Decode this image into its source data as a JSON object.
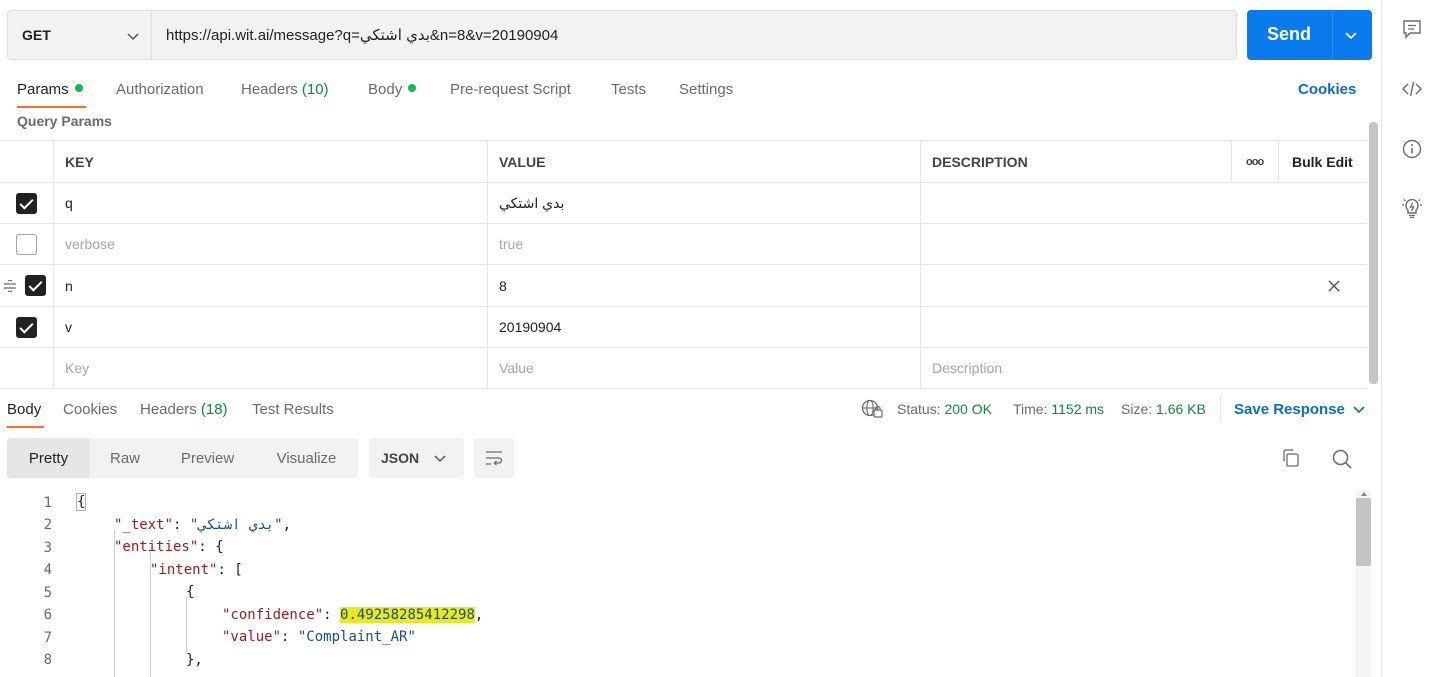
{
  "request": {
    "method": "GET",
    "url": "https://api.wit.ai/message?q=بدي اشتكي&n=8&v=20190904",
    "send_label": "Send"
  },
  "request_tabs": {
    "params": "Params",
    "authorization": "Authorization",
    "headers": "Headers",
    "headers_count": "(10)",
    "body": "Body",
    "pre_request": "Pre-request Script",
    "tests": "Tests",
    "settings": "Settings",
    "cookies": "Cookies"
  },
  "query_params": {
    "title": "Query Params",
    "columns": {
      "key": "KEY",
      "value": "VALUE",
      "description": "DESCRIPTION",
      "more": "ooo",
      "bulk_edit": "Bulk Edit"
    },
    "rows": [
      {
        "key": "q",
        "value": "بدي اشتكي",
        "description": "",
        "checked": true
      },
      {
        "key": "verbose",
        "value": "true",
        "description": "",
        "checked": false
      },
      {
        "key": "n",
        "value": "8",
        "description": "",
        "checked": true
      },
      {
        "key": "v",
        "value": "20190904",
        "description": "",
        "checked": true
      }
    ],
    "placeholder": {
      "key": "Key",
      "value": "Value",
      "description": "Description"
    }
  },
  "response_tabs": {
    "body": "Body",
    "cookies": "Cookies",
    "headers": "Headers",
    "headers_count": "(18)",
    "test_results": "Test Results"
  },
  "response_status": {
    "status_label": "Status:",
    "status_value": "200 OK",
    "time_label": "Time:",
    "time_value": "1152 ms",
    "size_label": "Size:",
    "size_value": "1.66 KB",
    "save_response": "Save Response"
  },
  "view_modes": {
    "pretty": "Pretty",
    "raw": "Raw",
    "preview": "Preview",
    "visualize": "Visualize",
    "format": "JSON"
  },
  "code_lines": {
    "numbers": [
      "1",
      "2",
      "3",
      "4",
      "5",
      "6",
      "7",
      "8"
    ],
    "l1": "{",
    "l2_key": "\"_text\"",
    "l2_val": "\"بدي اشتكي\"",
    "l3_key": "\"entities\"",
    "l3_rest": ": {",
    "l4_key": "\"intent\"",
    "l4_rest": ": [",
    "l5": "{",
    "l6_key": "\"confidence\"",
    "l6_val": "0.49258285412298",
    "l7_key": "\"value\"",
    "l7_val": "\"Complaint_AR\"",
    "l8": "},"
  },
  "colors": {
    "accent": "#ff6c37",
    "send": "#097bed",
    "link": "#0b6ccb",
    "success": "#0e8a3f"
  }
}
